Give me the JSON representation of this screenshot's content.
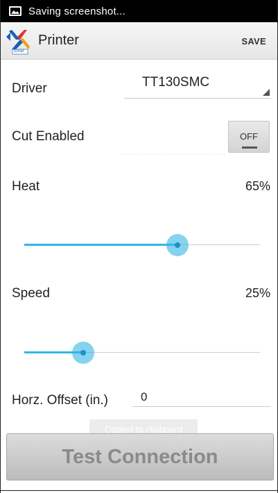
{
  "status_bar": {
    "text": "Saving screenshot...",
    "icon": "image-icon"
  },
  "action_bar": {
    "logo_text": "solar",
    "title": "Printer",
    "save_label": "SAVE"
  },
  "driver": {
    "label": "Driver",
    "value": "TT130SMC"
  },
  "cut": {
    "label": "Cut Enabled",
    "toggle_text": "OFF",
    "enabled": false
  },
  "heat": {
    "label": "Heat",
    "value_text": "65%",
    "value": 65
  },
  "speed": {
    "label": "Speed",
    "value_text": "25%",
    "value": 25
  },
  "offset": {
    "label": "Horz. Offset (in.)",
    "value": "0"
  },
  "toast": {
    "text": "Copied to clipboard"
  },
  "test_button": {
    "label": "Test Connection"
  },
  "colors": {
    "accent": "#33b5e5",
    "status_bar": "#000000",
    "logo_blue": "#1a5db4",
    "logo_red": "#e5322d",
    "logo_orange": "#f39c1a"
  }
}
